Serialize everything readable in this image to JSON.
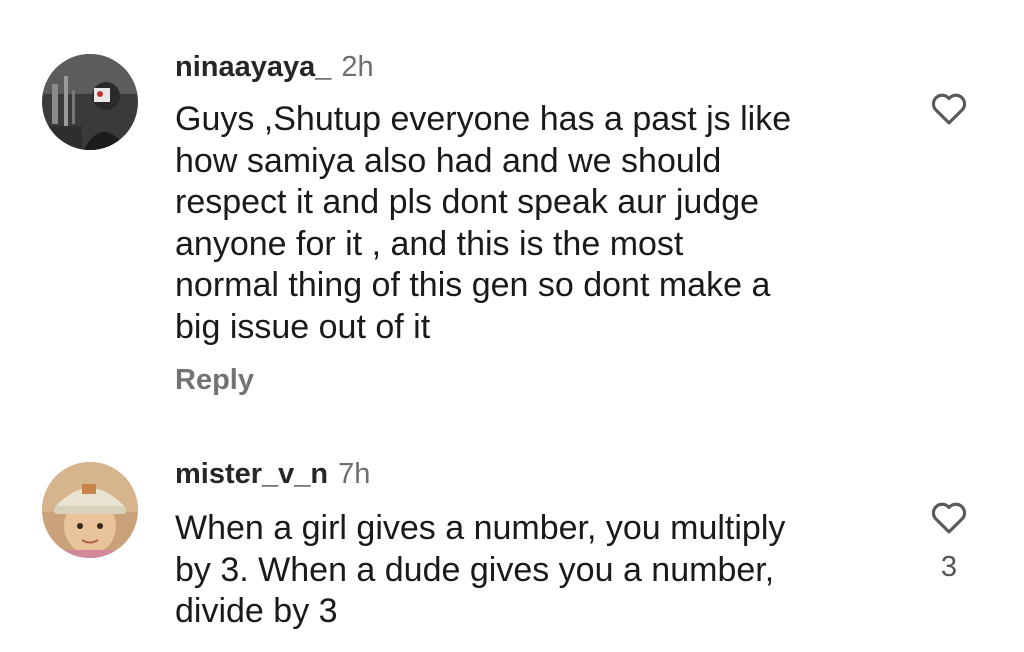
{
  "comments": [
    {
      "username": "ninaayaya_",
      "time": "2h",
      "text": "Guys ,Shutup everyone has a past js like\nhow samiya also had and we should\nrespect it and pls dont speak aur judge\nanyone for it , and this is the most\nnormal thing of this gen so dont make a\nbig issue out of it",
      "reply_label": "Reply",
      "like_icon": "heart-outline-icon"
    },
    {
      "username": "mister_v_n",
      "time": "7h",
      "text": "When a girl gives a number, you multiply\nby 3. When a dude gives you a number,\ndivide by 3",
      "like_count": "3",
      "like_icon": "heart-outline-icon"
    }
  ]
}
